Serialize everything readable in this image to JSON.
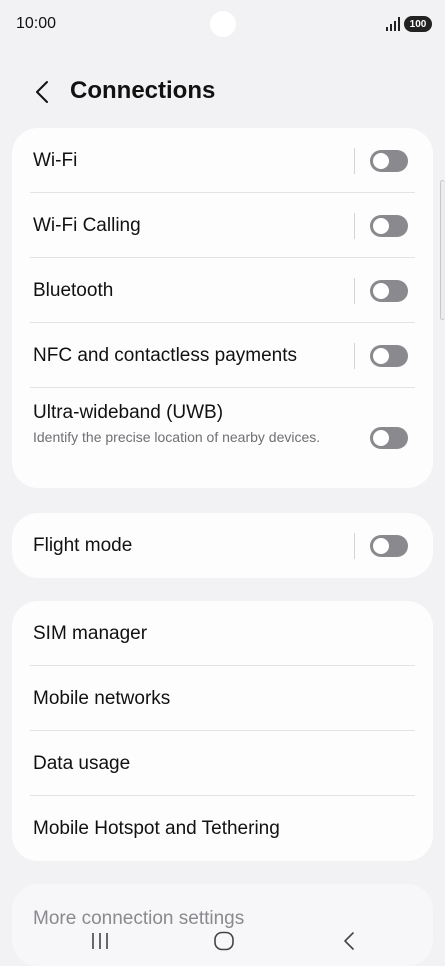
{
  "status_bar": {
    "time": "10:00",
    "battery": "100",
    "icons": [
      "signal-icon",
      "battery-icon"
    ]
  },
  "header": {
    "back_icon": "chevron-left-icon",
    "title": "Connections"
  },
  "group1": [
    {
      "label": "Wi-Fi",
      "toggle": false
    },
    {
      "label": "Wi-Fi Calling",
      "toggle": false
    },
    {
      "label": "Bluetooth",
      "toggle": false
    },
    {
      "label": "NFC and contactless payments",
      "toggle": false
    },
    {
      "label": "Ultra-wideband (UWB)",
      "description": "Identify the precise location of nearby devices.",
      "toggle": false
    }
  ],
  "group2": [
    {
      "label": "Flight mode",
      "toggle": false
    }
  ],
  "group3": [
    {
      "label": "SIM manager"
    },
    {
      "label": "Mobile networks"
    },
    {
      "label": "Data usage"
    },
    {
      "label": "Mobile Hotspot and Tethering"
    }
  ],
  "group4": [
    {
      "label": "More connection settings"
    }
  ],
  "nav_bar": {
    "icons": [
      "recents-icon",
      "home-icon",
      "back-icon"
    ]
  },
  "colors": {
    "background": "#f2f2f4",
    "card": "#fdfdfd",
    "toggle_off": "#8a8a8e"
  }
}
